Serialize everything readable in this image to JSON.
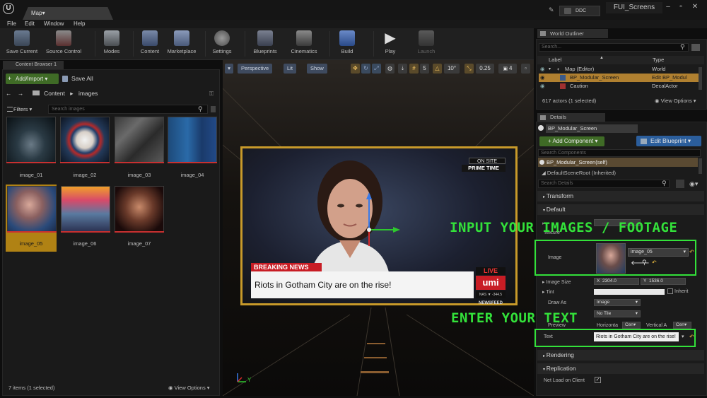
{
  "titlebar": {
    "map_tab": "Map",
    "ddc": "DDC",
    "project": "FUI_Screens"
  },
  "menu": [
    "File",
    "Edit",
    "Window",
    "Help"
  ],
  "toolbar": [
    {
      "label": "Save Current",
      "icon": "save-icon"
    },
    {
      "label": "Source Control",
      "icon": "source-control-icon"
    },
    {
      "label": "Modes",
      "icon": "modes-icon"
    },
    {
      "label": "Content",
      "icon": "content-icon"
    },
    {
      "label": "Marketplace",
      "icon": "marketplace-icon"
    },
    {
      "label": "Settings",
      "icon": "settings-icon"
    },
    {
      "label": "Blueprints",
      "icon": "blueprints-icon"
    },
    {
      "label": "Cinematics",
      "icon": "cinematics-icon"
    },
    {
      "label": "Build",
      "icon": "build-icon"
    },
    {
      "label": "Play",
      "icon": "play-icon"
    },
    {
      "label": "Launch",
      "icon": "launch-icon"
    }
  ],
  "content_browser": {
    "tab": "Content Browser 1",
    "add_import": "Add/Import",
    "save_all": "Save All",
    "breadcrumb": [
      "Content",
      "images"
    ],
    "filters": "Filters",
    "search_placeholder": "Search images",
    "assets": [
      {
        "name": "image_01",
        "selected": false
      },
      {
        "name": "image_02",
        "selected": false
      },
      {
        "name": "image_03",
        "selected": false
      },
      {
        "name": "image_04",
        "selected": false
      },
      {
        "name": "image_05",
        "selected": true
      },
      {
        "name": "image_06",
        "selected": false
      },
      {
        "name": "image_07",
        "selected": false
      }
    ],
    "status": "7 items (1 selected)",
    "view_options": "View Options"
  },
  "viewport": {
    "perspective": "Perspective",
    "lit": "Lit",
    "show": "Show",
    "grid_snap": "5",
    "rot_snap": "10°",
    "scale_snap": "0.25",
    "cam_speed": "4",
    "axis_label": "Y",
    "screen": {
      "on_site": "ON SITE",
      "prime_time": "PRIME TIME",
      "breaking": "BREAKING NEWS",
      "headline": "Riots in Gotham City are on the rise!",
      "live": "LIVE",
      "logo": "umi",
      "ticker": "NAS ▼ -344.5",
      "newsfeed": "NEWSFEED"
    }
  },
  "outliner": {
    "tab": "World Outliner",
    "search_placeholder": "Search...",
    "col_label": "Label",
    "col_type": "Type",
    "rows": [
      {
        "label": "Map (Editor)",
        "type": "World"
      },
      {
        "label": "BP_Modular_Screen",
        "type": "Edit BP_Modul"
      },
      {
        "label": "Caution",
        "type": "DecalActor"
      }
    ],
    "status": "617 actors (1 selected)",
    "view_options": "View Options"
  },
  "details": {
    "tab": "Details",
    "actor_name": "BP_Modular_Screen",
    "add_component": "Add Component",
    "edit_blueprint": "Edit Blueprint",
    "component_search": "Search Components",
    "component_self": "BP_Modular_Screen(self)",
    "component_root": "DefaultSceneRoot (Inherited)",
    "details_search": "Search Details",
    "cat_transform": "Transform",
    "cat_default": "Default",
    "label_texture": "Texture",
    "label_image": "Image",
    "image_value": "image_05",
    "label_image_size": "Image Size",
    "size_x": "2304.0",
    "size_y": "1536.0",
    "label_tint": "Tint",
    "inherit": "Inherit",
    "label_draw_as": "Draw As",
    "draw_as_value": "Image",
    "tiling_value": "No Tile",
    "label_preview": "Preview",
    "horizontal": "Horizonta",
    "horizontal_val": "Cen",
    "vertical": "Vertical A",
    "vertical_val": "Cen",
    "label_text": "Text",
    "text_value": "Riots in Gotham City are on the rise!",
    "cat_rendering": "Rendering",
    "cat_replication": "Replication",
    "label_net_load": "Net Load on Client"
  },
  "overlays": {
    "images_caption": "INPUT YOUR IMAGES / FOOTAGE",
    "text_caption": "ENTER YOUR TEXT",
    "color": "#33e13a"
  }
}
